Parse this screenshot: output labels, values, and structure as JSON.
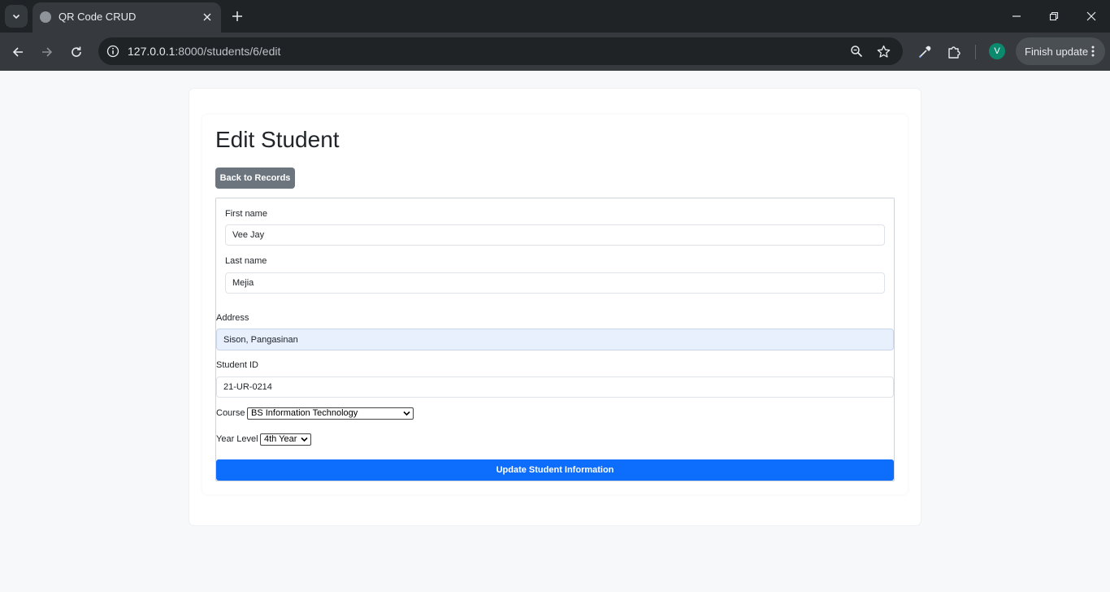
{
  "browser": {
    "tab_title": "QR Code CRUD",
    "url_host": "127.0.0.1",
    "url_path": ":8000/students/6/edit",
    "avatar_letter": "V",
    "finish_update_label": "Finish update"
  },
  "page": {
    "title": "Edit Student",
    "back_button": "Back to Records",
    "form": {
      "first_name_label": "First name",
      "first_name_value": "Vee Jay",
      "last_name_label": "Last name",
      "last_name_value": "Mejia",
      "address_label": "Address",
      "address_value": "Sison, Pangasinan",
      "student_id_label": "Student ID",
      "student_id_value": "21-UR-0214",
      "course_label": "Course",
      "course_value": "BS Information Technology",
      "year_level_label": "Year Level",
      "year_level_value": "4th Year",
      "submit_label": "Update Student Information"
    }
  },
  "colors": {
    "primary": "#0d6efd",
    "secondary": "#6c757d",
    "autofill": "#e8f0fe"
  }
}
